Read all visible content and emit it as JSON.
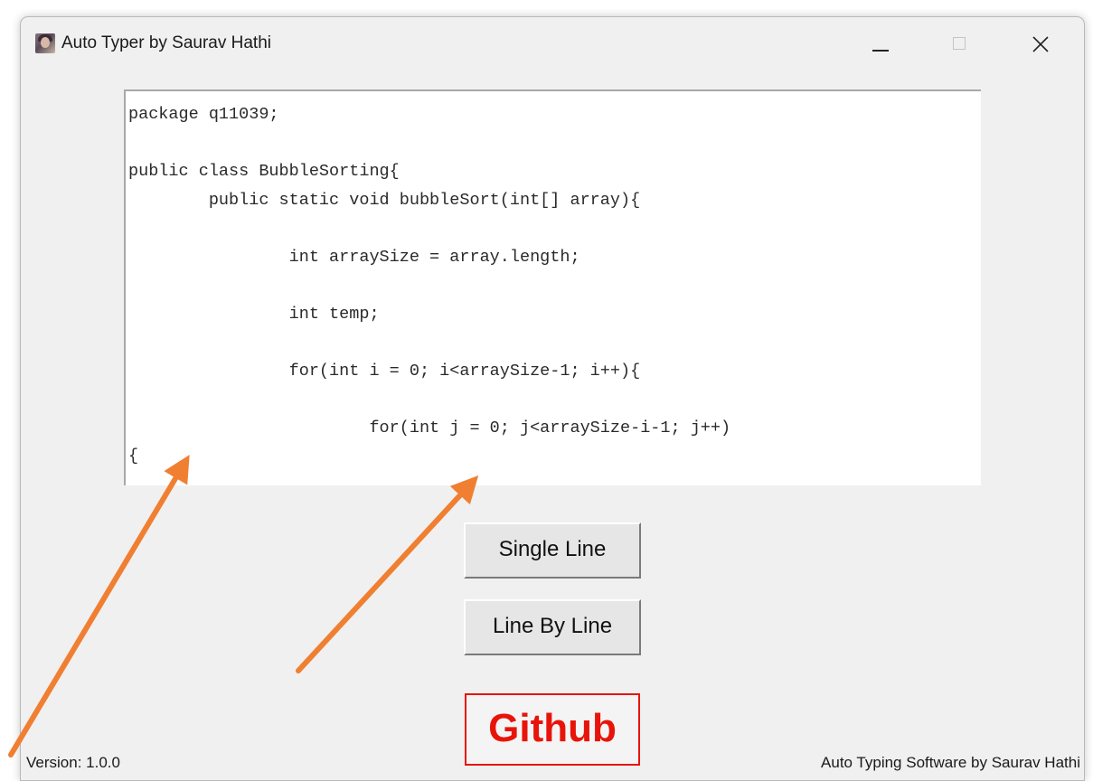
{
  "window": {
    "title": "Auto Typer by Saurav Hathi",
    "icon": "user-avatar-icon",
    "controls": [
      "minimize-icon",
      "maximize-icon",
      "close-icon"
    ]
  },
  "editor": {
    "text": "package q11039;\n\npublic class BubbleSorting{\n        public static void bubbleSort(int[] array){\n\n                int arraySize = array.length;\n\n                int temp;\n\n                for(int i = 0; i<arraySize-1; i++){\n\n                        for(int j = 0; j<arraySize-i-1; j++)\n{"
  },
  "buttons": {
    "single_line": "Single Line",
    "line_by_line": "Line By Line",
    "github": "Github"
  },
  "footer": {
    "version": "Version: 1.0.0",
    "credit": "Auto Typing Software by Saurav Hathi"
  },
  "colors": {
    "window_bg": "#f0f0f0",
    "github_accent": "#e8140a",
    "annotation_arrow": "#f07f32"
  }
}
